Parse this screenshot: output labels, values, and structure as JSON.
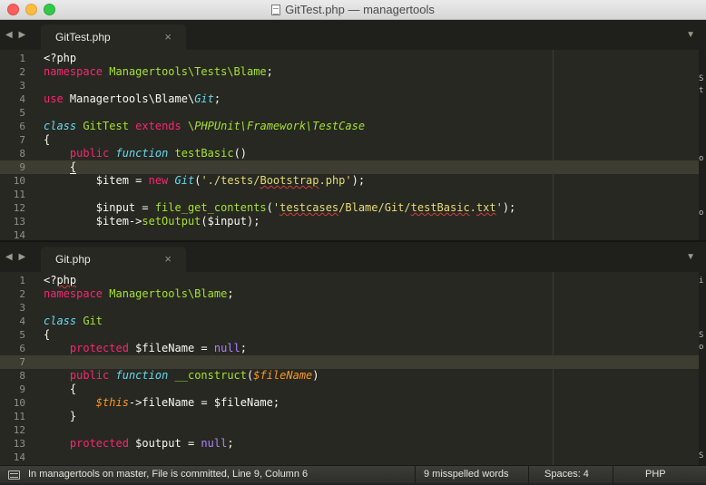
{
  "window": {
    "title": "GitTest.php — managertools"
  },
  "tabs": {
    "top": {
      "label": "GitTest.php",
      "close": "×",
      "nav": "◀ ▶",
      "menu": "▼"
    },
    "bottom": {
      "label": "Git.php",
      "close": "×",
      "nav": "◀ ▶",
      "menu": "▼"
    }
  },
  "editor_top": {
    "line_numbers": [
      "1",
      "2",
      "3",
      "4",
      "5",
      "6",
      "7",
      "8",
      "9",
      "10",
      "11",
      "12",
      "13",
      "14"
    ],
    "current_line": 9
  },
  "editor_bottom": {
    "line_numbers": [
      "1",
      "2",
      "3",
      "4",
      "5",
      "6",
      "7",
      "8",
      "9",
      "10",
      "11",
      "12",
      "13",
      "14"
    ],
    "current_line": 7
  },
  "right_panel_chars": [
    "S",
    "t",
    "o",
    "o",
    "i",
    "S",
    "o",
    "S"
  ],
  "status": {
    "vcs": "In managertools on master, File is committed, Line 9, Column 6",
    "spelling": "9 misspelled words",
    "spaces": "Spaces: 4",
    "syntax": "PHP"
  },
  "colors": {
    "background": "#272822",
    "keyword": "#f92672",
    "string": "#e6db74",
    "class": "#66d9ef",
    "function": "#a6e22e",
    "param": "#fd971f",
    "constant": "#ae81ff"
  },
  "icons": {
    "status": "panel-icon",
    "title": "document-icon"
  }
}
